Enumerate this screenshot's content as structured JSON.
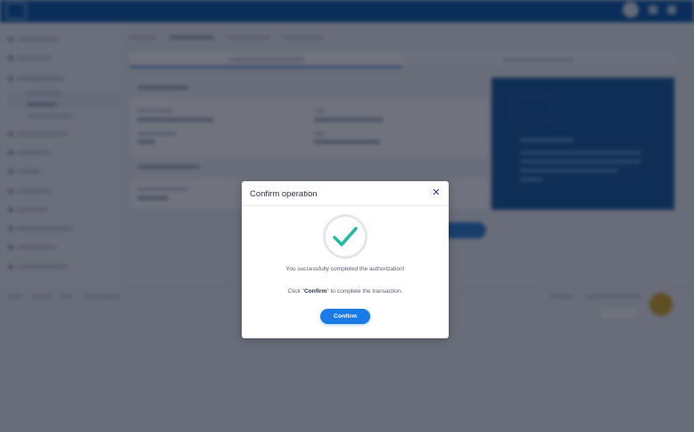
{
  "modal": {
    "title": "Confirm operation",
    "close_icon": "close-icon",
    "status_icon": "check-circle-icon",
    "success_message": "You successfully completed the authorization!",
    "instruction_prefix": "Click \"",
    "instruction_emphasis": "Confirm",
    "instruction_suffix": "\" to complete the transaction.",
    "confirm_label": "Confirm"
  },
  "colors": {
    "accent": "#1a7ae6",
    "check": "#27b8a4",
    "header": "#0d5aa7",
    "overlay": "rgba(8,14,32,0.58)"
  }
}
